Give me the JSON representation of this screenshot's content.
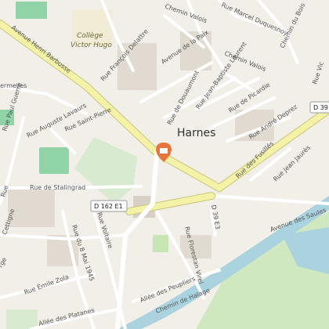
{
  "map": {
    "place": "Harnes",
    "poi": {
      "line1": "Collège",
      "line2": "Victor Hugo"
    },
    "roads": {
      "henri_barbusse": "Avenue Henri Barbusse",
      "lavaurs": "Rue Auguste Lavaurs",
      "saint_pierre": "Rue Saint-Pierre",
      "delattre": "Rue François Delattre",
      "paul_guerre": "Rue Paul Guerre",
      "stalingrad": "Rue de Stalingrad",
      "valois": "Chemin Valois",
      "marcel": "Rue Marcel Duquesnoy",
      "paix": "Avenue de la Paix",
      "douaumont": "Rue de Douaumont",
      "jb_laurent": "Rue Jean-Baptiste Laurent",
      "picardie": "Rue de Picardie",
      "andre": "Rue André Deprez",
      "fusilles": "Rue des Fusillés",
      "jean_jaures": "Rue Jean Jaurès",
      "saules": "Avenue des Saules",
      "voltaire": "Rue Voltaire",
      "mai": "Rue du 8 Mai 1945",
      "florestan": "Rue Florestan Virel",
      "emile_zola": "Rue Émile Zola",
      "peupliers": "Allée des Peupliers",
      "halage": "Chemin de Halage",
      "platanes": "Allée des Platanes",
      "vermelles": "ermelles",
      "chemin_bois": "Chemin du Bois",
      "cettigne": "Cettigne",
      "rue_vic": "Rue Vic",
      "rue_g": "Rue",
      "rge": "rge",
      "d39e3": "D 39 E3"
    },
    "shields": {
      "d162": "D 162 E1",
      "d39": "D 39"
    },
    "marker_icon": "calendar-pin-icon",
    "colors": {
      "background": "#f2efe9",
      "road_major": "#f4f2a6",
      "road_minor": "#ffffff",
      "water": "#aad3df",
      "park": "#c8e6b5",
      "pitch": "#8fd3a7",
      "marker": "#e8743b"
    }
  }
}
